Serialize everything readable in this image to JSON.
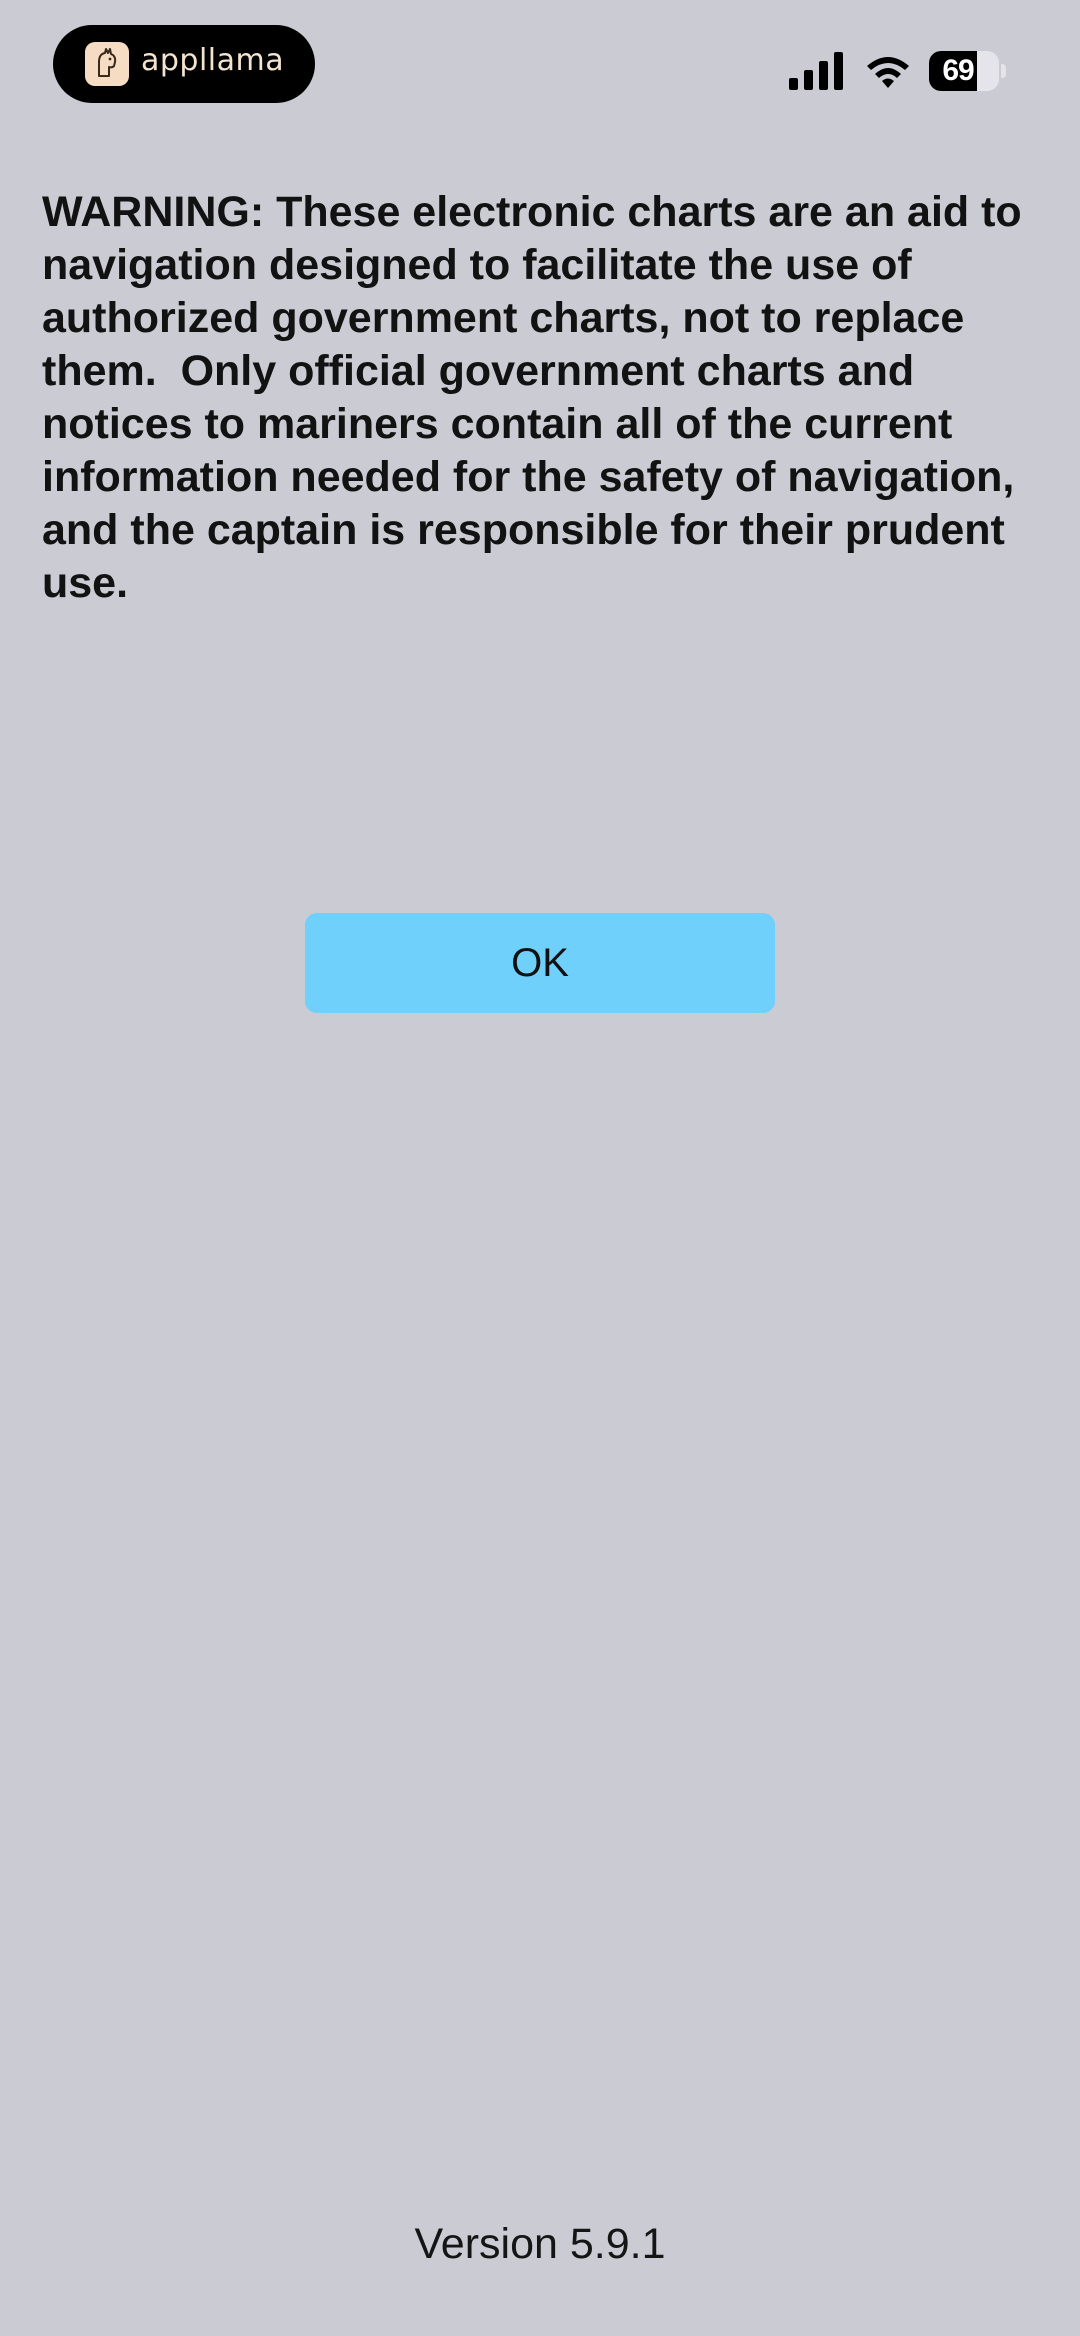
{
  "status_bar": {
    "app_badge_text": "appllama",
    "battery_level": "69",
    "battery_percent": 69,
    "icons": [
      "appllama-logo-icon",
      "cellular-signal-icon",
      "wifi-icon",
      "battery-icon"
    ]
  },
  "warning": {
    "text": "WARNING: These electronic charts are an aid to navigation designed to facilitate the use of authorized government charts, not to replace them.  Only official government charts and notices to mariners contain all of the current information needed for the safety of navigation, and the captain is responsible for their prudent use."
  },
  "ok_button": {
    "label": "OK"
  },
  "footer": {
    "version": "Version 5.9.1"
  },
  "colors": {
    "background": "#cbcbd4",
    "button": "#6fd0fb",
    "island": "#000000"
  }
}
